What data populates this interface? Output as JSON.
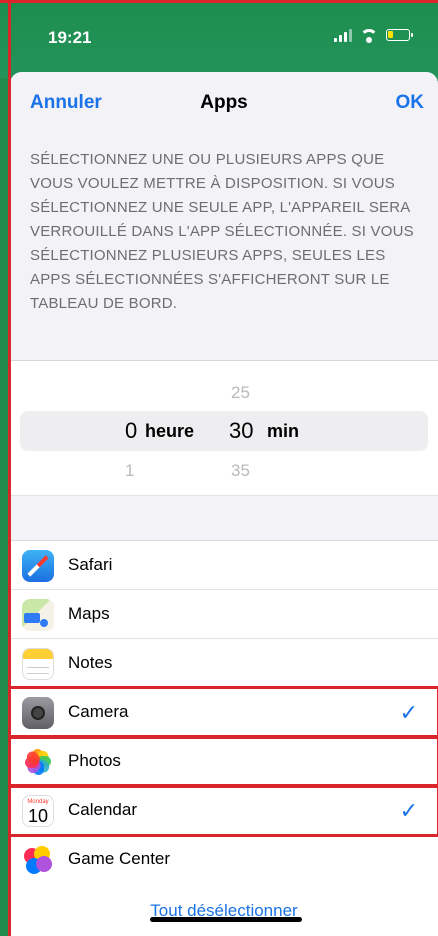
{
  "status_bar": {
    "time": "19:21"
  },
  "nav": {
    "cancel": "Annuler",
    "title": "Apps",
    "ok": "OK"
  },
  "description": "SÉLECTIONNEZ UNE OU PLUSIEURS APPS QUE VOUS VOULEZ METTRE À DISPOSITION. SI VOUS SÉLECTIONNEZ UNE SEULE APP, L'APPAREIL SERA VERROUILLÉ DANS L'APP SÉLECTIONNÉE. SI VOUS SÉLECTIONNEZ PLUSIEURS APPS, SEULES LES APPS SÉLECTIONNÉES S'AFFICHERONT SUR LE TABLEAU DE BORD.",
  "picker": {
    "hours": {
      "above": "",
      "selected": "0",
      "below": "1",
      "unit": "heure"
    },
    "minutes": {
      "above": "25",
      "selected": "30",
      "below": "35",
      "unit": "min"
    }
  },
  "apps": [
    {
      "name": "Safari",
      "icon": "safari-icon",
      "checked": false
    },
    {
      "name": "Maps",
      "icon": "maps-icon",
      "checked": false
    },
    {
      "name": "Notes",
      "icon": "notes-icon",
      "checked": false
    },
    {
      "name": "Camera",
      "icon": "camera-icon",
      "checked": true
    },
    {
      "name": "Photos",
      "icon": "photos-icon",
      "checked": false
    },
    {
      "name": "Calendar",
      "icon": "calendar-icon",
      "checked": true,
      "icon_day": "Monday",
      "icon_date": "10"
    },
    {
      "name": "Game Center",
      "icon": "game-center-icon",
      "checked": false
    }
  ],
  "check_glyph": "✓",
  "deselect_all": "Tout désélectionner",
  "colors": {
    "accent": "#1a73e8",
    "status_bar": "#1f8a4c",
    "highlight": "#d9262b"
  }
}
